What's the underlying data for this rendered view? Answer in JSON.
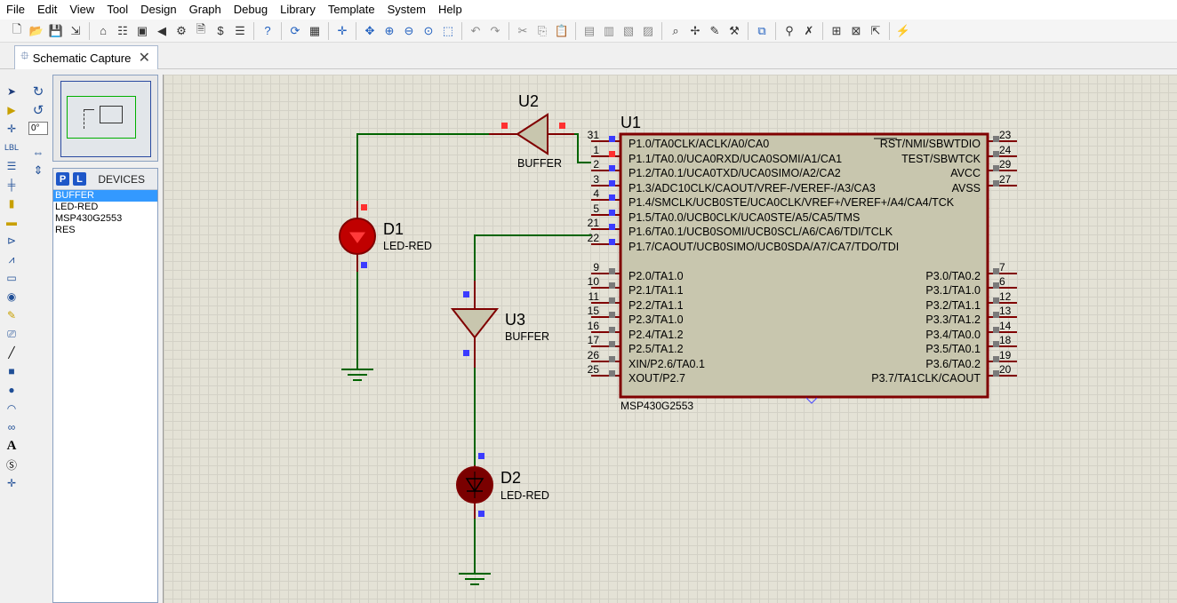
{
  "menu": [
    "File",
    "Edit",
    "View",
    "Tool",
    "Design",
    "Graph",
    "Debug",
    "Library",
    "Template",
    "System",
    "Help"
  ],
  "toolbar_icons": [
    {
      "name": "new-file-icon",
      "glyph": "🗋"
    },
    {
      "name": "open-folder-icon",
      "glyph": "📂"
    },
    {
      "name": "save-icon",
      "glyph": "💾"
    },
    {
      "name": "import-icon",
      "glyph": "⇲"
    },
    {
      "sep": true
    },
    {
      "name": "home-icon",
      "glyph": "⌂"
    },
    {
      "name": "netlist-icon",
      "glyph": "☷"
    },
    {
      "name": "chip-icon",
      "glyph": "▣"
    },
    {
      "name": "play-back-icon",
      "glyph": "◀"
    },
    {
      "name": "gear-icon",
      "glyph": "⚙"
    },
    {
      "name": "document-icon",
      "glyph": "🗎"
    },
    {
      "name": "bom-icon",
      "glyph": "$"
    },
    {
      "name": "report-icon",
      "glyph": "☰"
    },
    {
      "sep": true
    },
    {
      "name": "help-icon",
      "glyph": "?"
    },
    {
      "sep": true
    },
    {
      "name": "refresh-icon",
      "glyph": "⟳"
    },
    {
      "name": "grid-icon",
      "glyph": "▦"
    },
    {
      "sep": true
    },
    {
      "name": "origin-icon",
      "glyph": "✛"
    },
    {
      "sep": true
    },
    {
      "name": "pan-icon",
      "glyph": "✥"
    },
    {
      "name": "zoom-in-icon",
      "glyph": "⊕"
    },
    {
      "name": "zoom-out-icon",
      "glyph": "⊖"
    },
    {
      "name": "zoom-all-icon",
      "glyph": "⊙"
    },
    {
      "name": "zoom-area-icon",
      "glyph": "⬚"
    },
    {
      "sep": true
    },
    {
      "name": "undo-icon",
      "glyph": "↶"
    },
    {
      "name": "redo-icon",
      "glyph": "↷"
    },
    {
      "sep": true
    },
    {
      "name": "cut-icon",
      "glyph": "✂"
    },
    {
      "name": "copy-icon",
      "glyph": "⎘"
    },
    {
      "name": "paste-icon",
      "glyph": "📋"
    },
    {
      "sep": true
    },
    {
      "name": "block-copy-icon",
      "glyph": "▤"
    },
    {
      "name": "block-move-icon",
      "glyph": "▥"
    },
    {
      "name": "block-rotate-icon",
      "glyph": "▧"
    },
    {
      "name": "block-delete-icon",
      "glyph": "▨"
    },
    {
      "sep": true
    },
    {
      "name": "pick-device-icon",
      "glyph": "⌕"
    },
    {
      "name": "make-device-icon",
      "glyph": "✢"
    },
    {
      "name": "packaging-icon",
      "glyph": "✎"
    },
    {
      "name": "decompose-icon",
      "glyph": "⚒"
    },
    {
      "sep": true
    },
    {
      "name": "wire-autorouter-icon",
      "glyph": "⧉"
    },
    {
      "sep": true
    },
    {
      "name": "search-icon",
      "glyph": "⚲"
    },
    {
      "name": "property-assign-icon",
      "glyph": "✗"
    },
    {
      "sep": true
    },
    {
      "name": "new-sheet-icon",
      "glyph": "⊞"
    },
    {
      "name": "remove-sheet-icon",
      "glyph": "⊠"
    },
    {
      "name": "goto-sheet-icon",
      "glyph": "⇱"
    },
    {
      "sep": true
    },
    {
      "name": "electrical-rule-check-icon",
      "glyph": "⚡"
    }
  ],
  "tab": {
    "label": "Schematic Capture",
    "close": "✕"
  },
  "angle_value": "0°",
  "devices": {
    "title": "DEVICES",
    "p_label": "P",
    "l_label": "L",
    "items": [
      "BUFFER",
      "LED-RED",
      "MSP430G2553",
      "RES"
    ],
    "selected": "BUFFER"
  },
  "schematic": {
    "u1": {
      "ref": "U1",
      "part": "MSP430G2553",
      "left_pins": [
        {
          "num": "31",
          "label": "P1.0/TA0CLK/ACLK/A0/CA0"
        },
        {
          "num": "1",
          "label": "P1.1/TA0.0/UCA0RXD/UCA0SOMI/A1/CA1"
        },
        {
          "num": "2",
          "label": "P1.2/TA0.1/UCA0TXD/UCA0SIMO/A2/CA2"
        },
        {
          "num": "3",
          "label": "P1.3/ADC10CLK/CAOUT/VREF-/VEREF-/A3/CA3"
        },
        {
          "num": "4",
          "label": "P1.4/SMCLK/UCB0STE/UCA0CLK/VREF+/VEREF+/A4/CA4/TCK"
        },
        {
          "num": "5",
          "label": "P1.5/TA0.0/UCB0CLK/UCA0STE/A5/CA5/TMS"
        },
        {
          "num": "21",
          "label": "P1.6/TA0.1/UCB0SOMI/UCB0SCL/A6/CA6/TDI/TCLK"
        },
        {
          "num": "22",
          "label": "P1.7/CAOUT/UCB0SIMO/UCB0SDA/A7/CA7/TDO/TDI"
        },
        {
          "num": "9",
          "label": "P2.0/TA1.0"
        },
        {
          "num": "10",
          "label": "P2.1/TA1.1"
        },
        {
          "num": "11",
          "label": "P2.2/TA1.1"
        },
        {
          "num": "15",
          "label": "P2.3/TA1.0"
        },
        {
          "num": "16",
          "label": "P2.4/TA1.2"
        },
        {
          "num": "17",
          "label": "P2.5/TA1.2"
        },
        {
          "num": "26",
          "label": "XIN/P2.6/TA0.1"
        },
        {
          "num": "25",
          "label": "XOUT/P2.7"
        }
      ],
      "right_pins": [
        {
          "num": "23",
          "label": "RST/NMI/SBWTDIO",
          "overline": "RST"
        },
        {
          "num": "24",
          "label": "TEST/SBWTCK"
        },
        {
          "num": "29",
          "label": "AVCC"
        },
        {
          "num": "27",
          "label": "AVSS"
        },
        {
          "num": "7",
          "label": "P3.0/TA0.2"
        },
        {
          "num": "6",
          "label": "P3.1/TA1.0"
        },
        {
          "num": "12",
          "label": "P3.2/TA1.1"
        },
        {
          "num": "13",
          "label": "P3.3/TA1.2"
        },
        {
          "num": "14",
          "label": "P3.4/TA0.0"
        },
        {
          "num": "18",
          "label": "P3.5/TA0.1"
        },
        {
          "num": "19",
          "label": "P3.6/TA0.2"
        },
        {
          "num": "20",
          "label": "P3.7/TA1CLK/CAOUT"
        }
      ]
    },
    "u2": {
      "ref": "U2",
      "part": "BUFFER"
    },
    "u3": {
      "ref": "U3",
      "part": "BUFFER"
    },
    "d1": {
      "ref": "D1",
      "part": "LED-RED"
    },
    "d2": {
      "ref": "D2",
      "part": "LED-RED"
    }
  },
  "colors": {
    "wire": "#006400",
    "chip_body": "#c8c6ae",
    "outline": "#800000",
    "pin_blue": "#3b3bff",
    "pin_red": "#ff3030",
    "grid_bg": "#e4e2d6"
  }
}
